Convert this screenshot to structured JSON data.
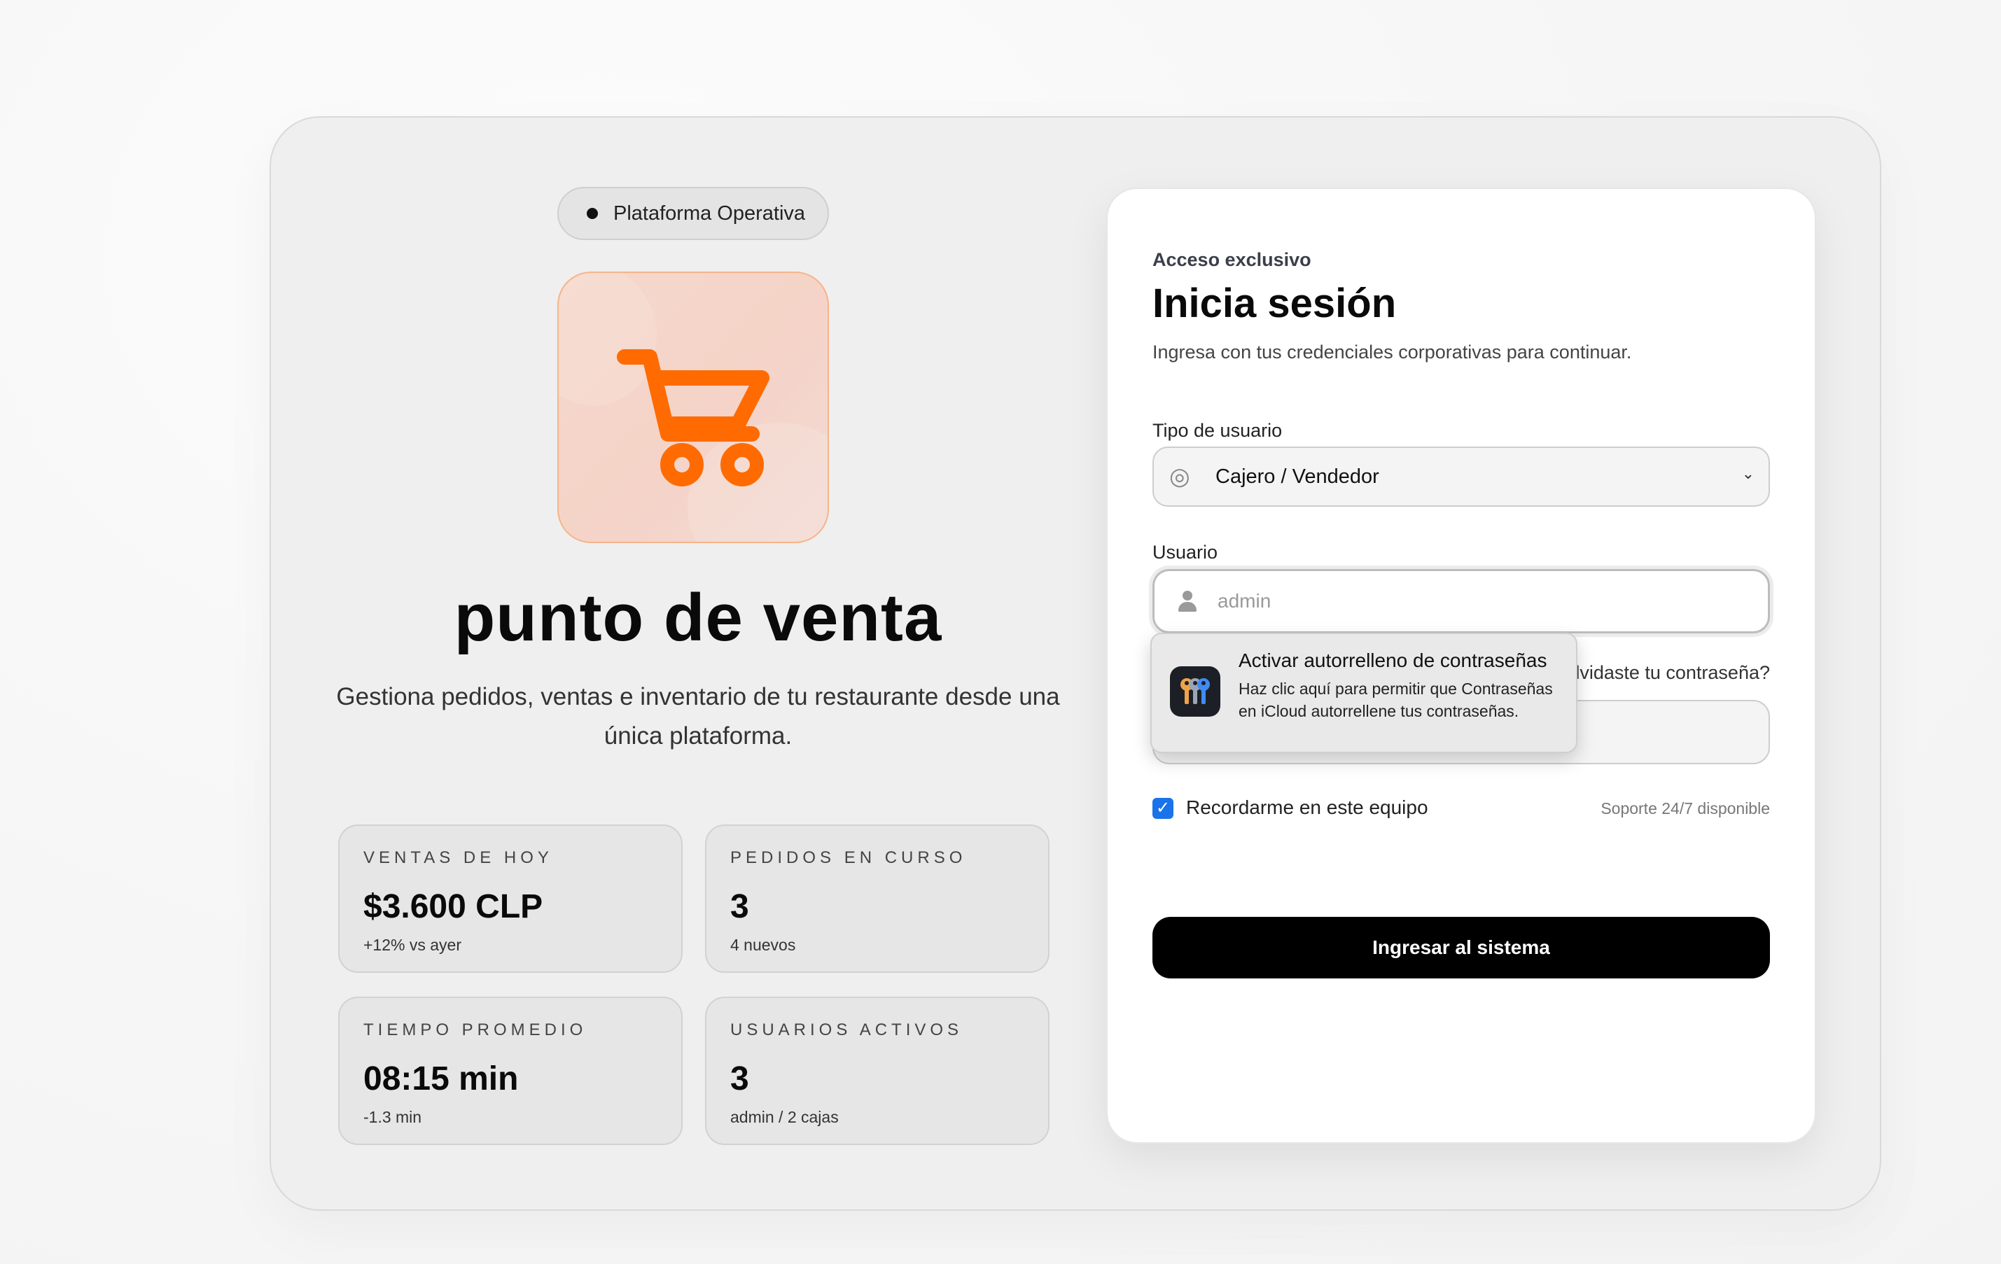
{
  "left": {
    "status_pill": "Plataforma Operativa",
    "brand_title": "punto de venta",
    "brand_subtitle": "Gestiona pedidos, ventas e inventario de tu restaurante desde una única plataforma.",
    "accent_color": "#ff6b00",
    "stats": [
      {
        "label": "VENTAS DE HOY",
        "value": "$3.600 CLP",
        "note": "+12% vs ayer"
      },
      {
        "label": "PEDIDOS EN CURSO",
        "value": "3",
        "note": "4 nuevos"
      },
      {
        "label": "TIEMPO PROMEDIO",
        "value": "08:15 min",
        "note": "-1.3 min"
      },
      {
        "label": "USUARIOS ACTIVOS",
        "value": "3",
        "note": "admin / 2 cajas"
      }
    ]
  },
  "login": {
    "eyebrow": "Acceso exclusivo",
    "title": "Inicia sesión",
    "description": "Ingresa con tus credenciales corporativas para continuar.",
    "user_type_label": "Tipo de usuario",
    "user_type_value": "Cajero / Vendedor",
    "username_label": "Usuario",
    "username_value": "admin",
    "forgot_link": "¿Olvidaste tu contraseña?",
    "remember_label": "Recordarme en este equipo",
    "remember_checked": true,
    "support_text": "Soporte 24/7 disponible",
    "submit_label": "Ingresar al sistema"
  },
  "autofill": {
    "title": "Activar autorrelleno de contraseñas",
    "body": "Haz clic aquí para permitir que Contraseñas en iCloud autorrellene tus contraseñas."
  }
}
